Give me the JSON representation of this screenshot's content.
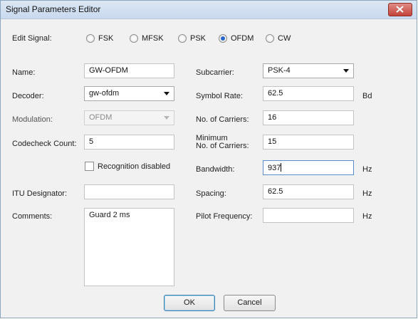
{
  "window": {
    "title": "Signal Parameters Editor"
  },
  "edit_signal": {
    "label": "Edit Signal:",
    "options": [
      "FSK",
      "MFSK",
      "PSK",
      "OFDM",
      "CW"
    ],
    "selected": "OFDM"
  },
  "left": {
    "name_label": "Name:",
    "name_value": "GW-OFDM",
    "decoder_label": "Decoder:",
    "decoder_value": "gw-ofdm",
    "modulation_label": "Modulation:",
    "modulation_value": "OFDM",
    "codecheck_label": "Codecheck Count:",
    "codecheck_value": "5",
    "recognition_label": "Recognition disabled",
    "itu_label": "ITU Designator:",
    "itu_value": "",
    "comments_label": "Comments:",
    "comments_value": "Guard 2 ms"
  },
  "right": {
    "subcarrier_label": "Subcarrier:",
    "subcarrier_value": "PSK-4",
    "symbol_rate_label": "Symbol Rate:",
    "symbol_rate_value": "62.5",
    "symbol_rate_unit": "Bd",
    "carriers_label": "No. of Carriers:",
    "carriers_value": "16",
    "min_carriers_label_1": "Minimum",
    "min_carriers_label_2": "No. of Carriers:",
    "min_carriers_value": "15",
    "bandwidth_label": "Bandwidth:",
    "bandwidth_value": "937",
    "bandwidth_unit": "Hz",
    "spacing_label": "Spacing:",
    "spacing_value": "62.5",
    "spacing_unit": "Hz",
    "pilot_label": "Pilot Frequency:",
    "pilot_value": "",
    "pilot_unit": "Hz"
  },
  "buttons": {
    "ok": "OK",
    "cancel": "Cancel"
  },
  "colors": {
    "accent": "#2a66c8",
    "close": "#c2443a",
    "titlebar": "#dbe7f5"
  }
}
